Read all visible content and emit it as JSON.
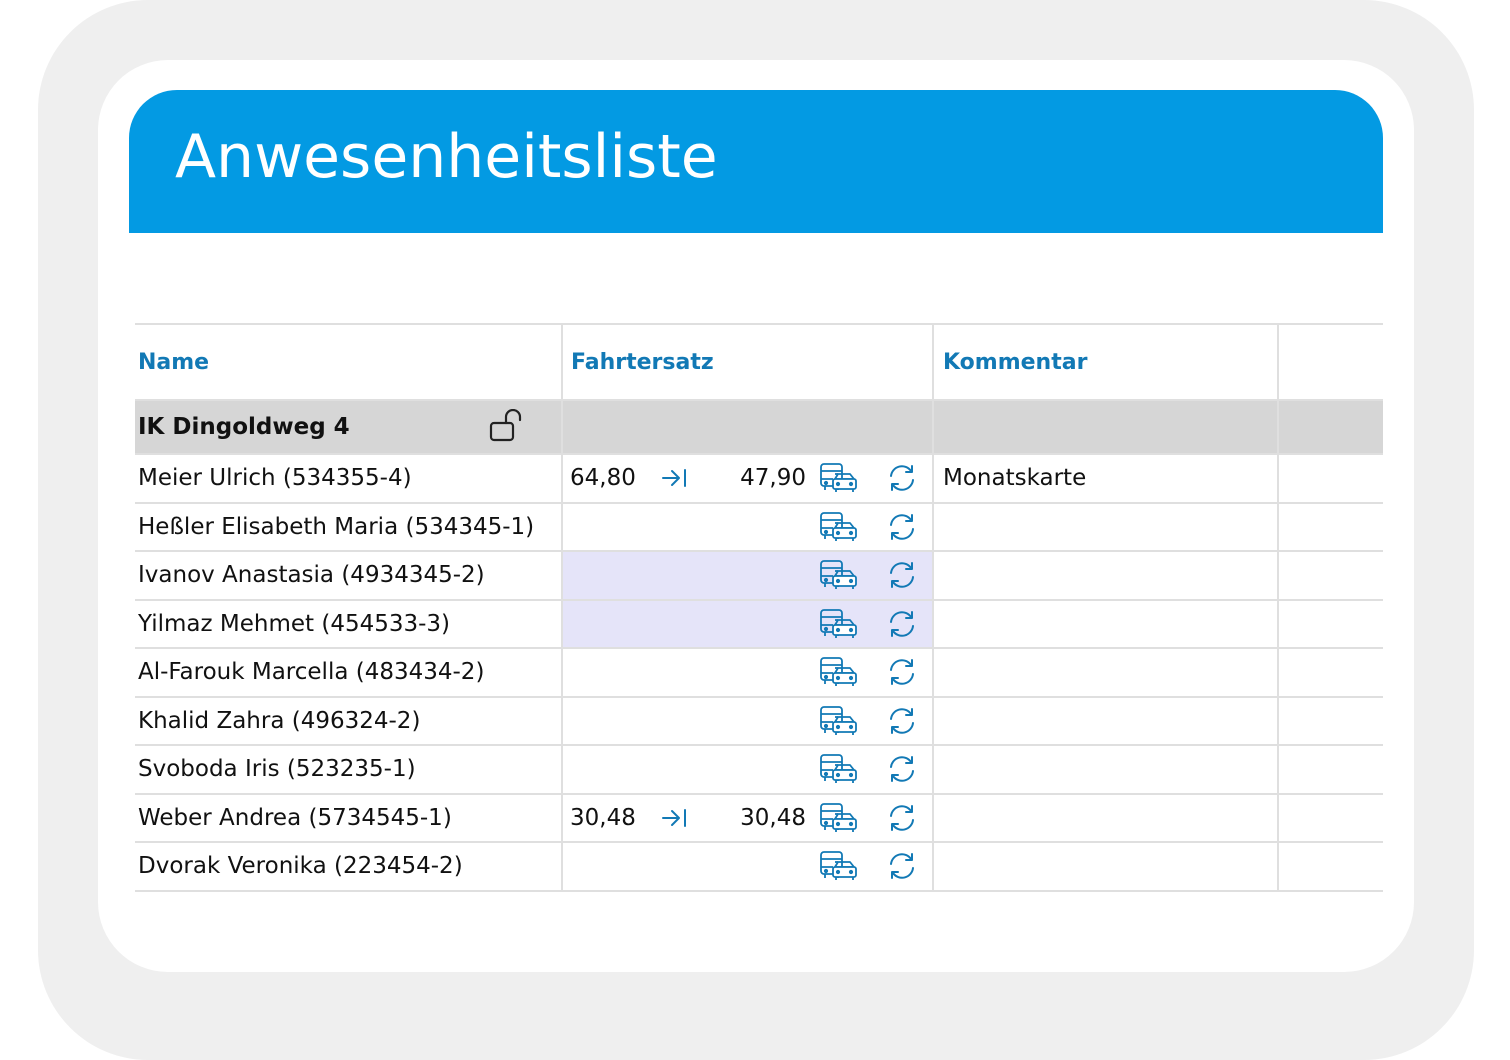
{
  "title": "Anwesenheitsliste",
  "columns": {
    "name": "Name",
    "fare": "Fahrtersatz",
    "comment": "Kommentar",
    "extra": ""
  },
  "group": {
    "name": "IK Dingoldweg 4",
    "lock_icon": "unlocked-lock-icon"
  },
  "icons": {
    "arrow": "arrow-to-right-icon",
    "transport": "bus-and-car-icon",
    "refresh": "refresh-icon"
  },
  "colors": {
    "header_bg": "#039ae3",
    "header_text": "#ffffff",
    "column_header_text": "#1279b5",
    "group_row_bg": "#d6d6d6",
    "highlight_bg": "#e5e4f9",
    "icon": "#1279b5"
  },
  "rows": [
    {
      "name": "Meier Ulrich (534355-4)",
      "fare_from": "64,80",
      "fare_to": "47,90",
      "comment": "Monatskarte",
      "highlighted": false
    },
    {
      "name": "Heßler Elisabeth Maria (534345-1)",
      "fare_from": "",
      "fare_to": "",
      "comment": "",
      "highlighted": false
    },
    {
      "name": "Ivanov Anastasia (4934345-2)",
      "fare_from": "",
      "fare_to": "",
      "comment": "",
      "highlighted": true
    },
    {
      "name": "Yilmaz Mehmet (454533-3)",
      "fare_from": "",
      "fare_to": "",
      "comment": "",
      "highlighted": true
    },
    {
      "name": "Al-Farouk Marcella (483434-2)",
      "fare_from": "",
      "fare_to": "",
      "comment": "",
      "highlighted": false
    },
    {
      "name": "Khalid Zahra (496324-2)",
      "fare_from": "",
      "fare_to": "",
      "comment": "",
      "highlighted": false
    },
    {
      "name": "Svoboda Iris (523235-1)",
      "fare_from": "",
      "fare_to": "",
      "comment": "",
      "highlighted": false
    },
    {
      "name": "Weber Andrea (5734545-1)",
      "fare_from": "30,48",
      "fare_to": "30,48",
      "comment": "",
      "highlighted": false
    },
    {
      "name": "Dvorak Veronika (223454-2)",
      "fare_from": "",
      "fare_to": "",
      "comment": "",
      "highlighted": false
    }
  ]
}
